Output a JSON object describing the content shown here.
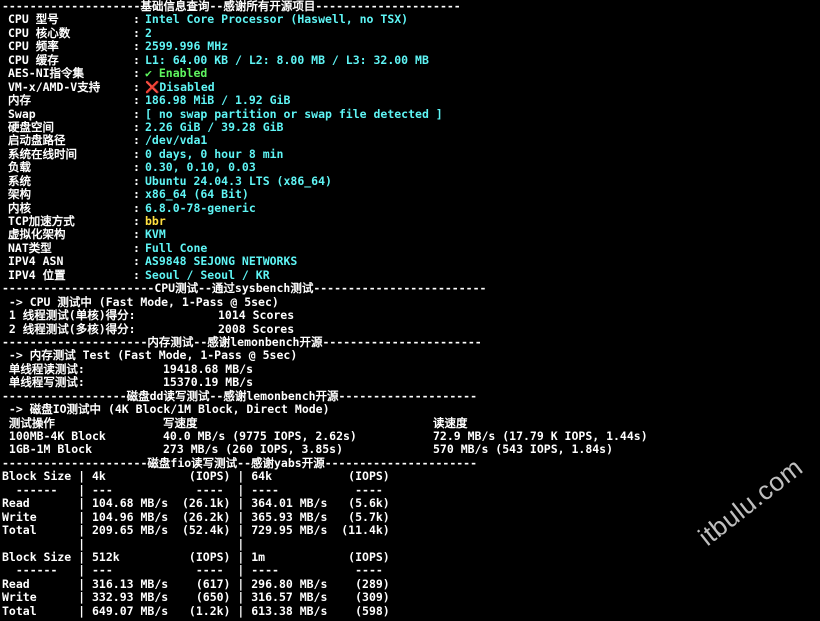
{
  "colors": {
    "background": "#000000",
    "text": "#ffffff",
    "cyan": "#5ff5f5",
    "green": "#5ff55f",
    "yellow": "#ffe040"
  },
  "basic": {
    "header": "--------------------基础信息查询--感谢所有开源项目---------------------",
    "rows": [
      {
        "key": "CPU 型号",
        "sep": ":",
        "value": "Intel Core Processor (Haswell, no TSX)",
        "color": "cyan"
      },
      {
        "key": "CPU 核心数",
        "sep": ":",
        "value": "2",
        "color": "cyan"
      },
      {
        "key": "CPU 频率",
        "sep": ":",
        "value": "2599.996 MHz",
        "color": "cyan"
      },
      {
        "key": "CPU 缓存",
        "sep": ":",
        "value": "L1: 64.00 KB / L2: 8.00 MB / L3: 32.00 MB",
        "color": "cyan"
      },
      {
        "key": "AES-NI指令集",
        "sep": ":",
        "value": "✔ Enabled",
        "color": "green"
      },
      {
        "key": "VM-x/AMD-V支持",
        "sep": ":",
        "value": "❌Disabled",
        "color": "cyan"
      },
      {
        "key": "内存",
        "sep": ":",
        "value": "186.98 MiB / 1.92 GiB",
        "color": "cyan"
      },
      {
        "key": "Swap",
        "sep": ":",
        "value": "[ no swap partition or swap file detected ]",
        "color": "cyan"
      },
      {
        "key": "硬盘空间",
        "sep": ":",
        "value": "2.26 GiB / 39.28 GiB",
        "color": "cyan"
      },
      {
        "key": "启动盘路径",
        "sep": ":",
        "value": "/dev/vda1",
        "color": "cyan"
      },
      {
        "key": "系统在线时间",
        "sep": ":",
        "value": "0 days, 0 hour 8 min",
        "color": "cyan"
      },
      {
        "key": "负载",
        "sep": ":",
        "value": "0.30, 0.10, 0.03",
        "color": "cyan"
      },
      {
        "key": "系统",
        "sep": ":",
        "value": "Ubuntu 24.04.3 LTS (x86_64)",
        "color": "cyan"
      },
      {
        "key": "架构",
        "sep": ":",
        "value": "x86_64 (64 Bit)",
        "color": "cyan"
      },
      {
        "key": "内核",
        "sep": ":",
        "value": "6.8.0-78-generic",
        "color": "cyan"
      },
      {
        "key": "TCP加速方式",
        "sep": ":",
        "value": "bbr",
        "color": "yellow"
      },
      {
        "key": "虚拟化架构",
        "sep": ":",
        "value": "KVM",
        "color": "cyan"
      },
      {
        "key": "NAT类型",
        "sep": ":",
        "value": "Full Cone",
        "color": "cyan"
      },
      {
        "key": "IPV4 ASN",
        "sep": ":",
        "value": "AS9848 SEJONG NETWORKS",
        "color": "cyan"
      },
      {
        "key": "IPV4 位置",
        "sep": ":",
        "value": "Seoul / Seoul / KR",
        "color": "cyan"
      }
    ]
  },
  "cpu": {
    "header": "----------------------CPU测试--通过sysbench测试-------------------------",
    "subtitle": " -> CPU 测试中 (Fast Mode, 1-Pass @ 5sec)",
    "rows": [
      {
        "label": " 1 线程测试(单核)得分:",
        "value": "1014 Scores"
      },
      {
        "label": " 2 线程测试(多核)得分:",
        "value": "2008 Scores"
      }
    ]
  },
  "memory": {
    "header": "---------------------内存测试--感谢lemonbench开源-----------------------",
    "subtitle": " -> 内存测试 Test (Fast Mode, 1-Pass @ 5sec)",
    "rows": [
      {
        "label": " 单线程读测试:",
        "value": "19418.68 MB/s"
      },
      {
        "label": " 单线程写测试:",
        "value": "15370.19 MB/s"
      }
    ]
  },
  "disk_dd": {
    "header": "------------------磁盘dd读写测试--感谢lemonbench开源--------------------",
    "subtitle": " -> 磁盘IO测试中 (4K Block/1M Block, Direct Mode)",
    "col_headers": [
      " 测试操作",
      "写速度",
      "读速度"
    ],
    "rows": [
      {
        "op": " 100MB-4K Block",
        "write": "40.0 MB/s (9775 IOPS, 2.62s)",
        "read": "72.9 MB/s (17.79 K IOPS, 1.44s)"
      },
      {
        "op": " 1GB-1M Block",
        "write": "273 MB/s (260 IOPS, 3.85s)",
        "read": "570 MB/s (543 IOPS, 1.84s)"
      }
    ]
  },
  "disk_fio": {
    "header": "---------------------磁盘fio读写测试--感谢yabs开源----------------------",
    "lines": [
      "Block Size | 4k            (IOPS) | 64k           (IOPS)",
      "  ------   | ---            ----  | ----           ----",
      "Read       | 104.68 MB/s  (26.1k) | 364.01 MB/s   (5.6k)",
      "Write      | 104.96 MB/s  (26.2k) | 365.93 MB/s   (5.7k)",
      "Total      | 209.65 MB/s  (52.4k) | 729.95 MB/s  (11.4k)",
      "           |                      |",
      "Block Size | 512k          (IOPS) | 1m            (IOPS)",
      "  ------   | ---            ----  | ----           ----",
      "Read       | 316.13 MB/s    (617) | 296.80 MB/s    (289)",
      "Write      | 332.93 MB/s    (650) | 316.57 MB/s    (309)",
      "Total      | 649.07 MB/s   (1.2k) | 613.38 MB/s    (598)"
    ]
  },
  "watermark": "itbulu.com"
}
